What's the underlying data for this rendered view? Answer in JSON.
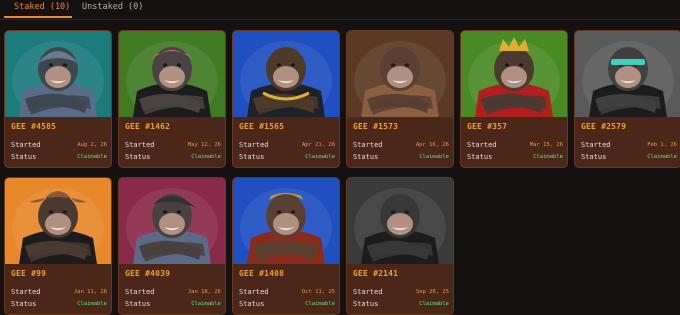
{
  "tabs": [
    {
      "label": "Staked (10)",
      "active": true
    },
    {
      "label": "Unstaked (0)",
      "active": false
    }
  ],
  "colors": {
    "accent": "#f0892a",
    "card_bg": "#4a2718",
    "date": "#e0a040",
    "claimable": "#6fe08a"
  },
  "labels": {
    "started": "Started",
    "status": "Status"
  },
  "cards": [
    {
      "name": "GEE #4585",
      "started": "Aug 2, 26",
      "status": "Claimable",
      "bg": "#1c7a7a",
      "fur": "#3e4650",
      "outfit": "#5a6b88",
      "accessory": "helmet"
    },
    {
      "name": "GEE #1462",
      "started": "May 12, 26",
      "status": "Claimable",
      "bg": "#3f7a22",
      "fur": "#4a4344",
      "outfit": "#1c1c1c",
      "accessory": "pink-bandana"
    },
    {
      "name": "GEE #1565",
      "started": "Apr 21, 26",
      "status": "Claimable",
      "bg": "#1f4fc0",
      "fur": "#4e3a2a",
      "outfit": "#20222a",
      "accessory": "gold-chains"
    },
    {
      "name": "GEE #1573",
      "started": "Apr 16, 26",
      "status": "Claimable",
      "bg": "#5a3a24",
      "fur": "#5a4030",
      "outfit": "#8a6040",
      "accessory": "jacket"
    },
    {
      "name": "GEE #357",
      "started": "Mar 15, 26",
      "status": "Claimable",
      "bg": "#4a8a24",
      "fur": "#4a3a30",
      "outfit": "#b01e1e",
      "accessory": "crown"
    },
    {
      "name": "GEE #2579",
      "started": "Feb 1, 26",
      "status": "Claimable",
      "bg": "#5a5a5a",
      "fur": "#404040",
      "outfit": "#1c1c1c",
      "accessory": "visor"
    },
    {
      "name": "GEE #99",
      "started": "Jan 11, 26",
      "status": "Claimable",
      "bg": "#e8882a",
      "fur": "#4a3a30",
      "outfit": "#1c1c1c",
      "accessory": "cowboy-hat"
    },
    {
      "name": "GEE #4039",
      "started": "Jan 18, 26",
      "status": "Claimable",
      "bg": "#8a2a4a",
      "fur": "#4a4040",
      "outfit": "#5a6b88",
      "accessory": "cap"
    },
    {
      "name": "GEE #1408",
      "started": "Oct 11, 25",
      "status": "Claimable",
      "bg": "#1f4fc0",
      "fur": "#5a4030",
      "outfit": "#8a2a1a",
      "accessory": "flannel"
    },
    {
      "name": "GEE #2141",
      "started": "Sep 26, 25",
      "status": "Claimable",
      "bg": "#3a3a3a",
      "fur": "#383838",
      "outfit": "#1c1c1c",
      "accessory": "none"
    }
  ]
}
